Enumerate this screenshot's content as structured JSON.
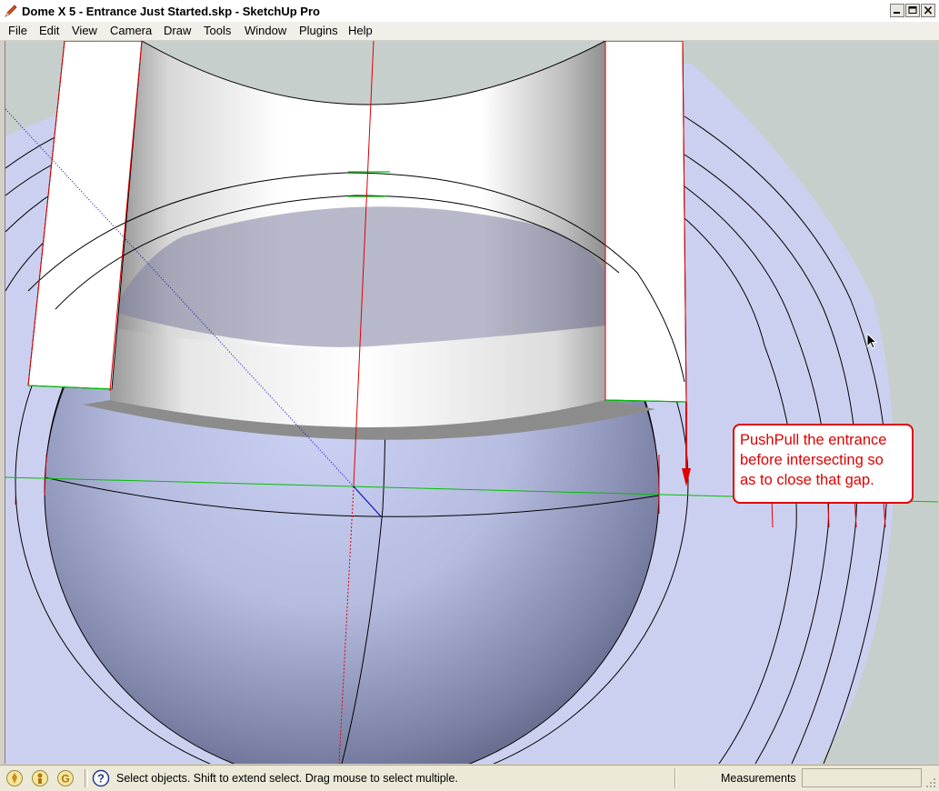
{
  "window": {
    "title": "Dome X 5 - Entrance Just Started.skp - SketchUp Pro",
    "app_icon": "sketchup-pencil-icon",
    "controls": [
      "minimize-icon",
      "maximize-icon",
      "close-icon"
    ]
  },
  "menu": {
    "items": [
      {
        "label": "File"
      },
      {
        "label": "Edit"
      },
      {
        "label": "View"
      },
      {
        "label": "Camera"
      },
      {
        "label": "Draw"
      },
      {
        "label": "Tools"
      },
      {
        "label": "Window"
      },
      {
        "label": "Plugins"
      },
      {
        "label": "Help"
      }
    ]
  },
  "viewport": {
    "annotation": {
      "text": "PushPull the entrance\nbefore intersecting so\nas to close that gap.",
      "color": "#e00000"
    },
    "colors": {
      "background": "#c7cfcd",
      "ground": "#ccd0f0",
      "red_axis": "#e00000",
      "green_axis": "#00c000",
      "blue_axis": "#0000c0"
    }
  },
  "status": {
    "icons": [
      "geo-location-icon",
      "credits-icon",
      "google-sign-in-icon",
      "help-icon"
    ],
    "message": "Select objects. Shift to extend select. Drag mouse to select multiple.",
    "measurements_label": "Measurements",
    "measurements_value": ""
  }
}
